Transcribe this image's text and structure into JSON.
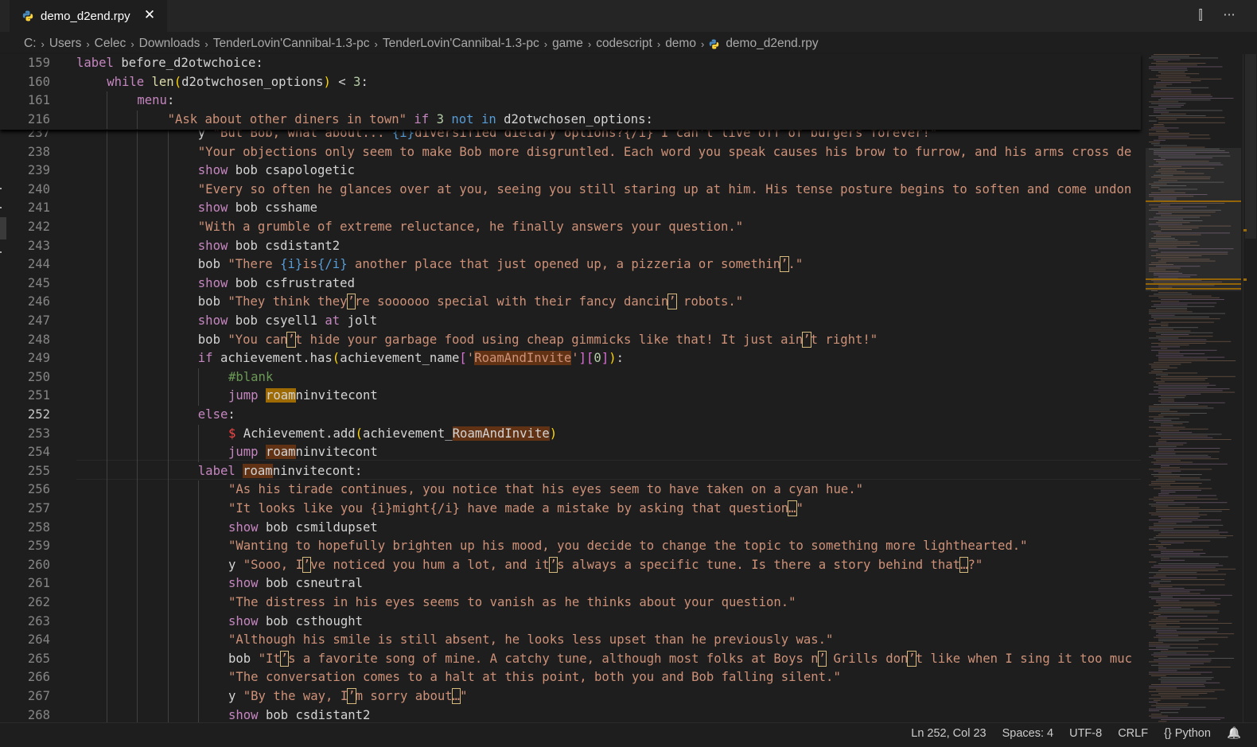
{
  "tab": {
    "filename": "demo_d2end.rpy",
    "close": "✕"
  },
  "tab_actions": {
    "split": "⫿",
    "more": "···"
  },
  "breadcrumb": [
    "C:",
    "Users",
    "Celec",
    "Downloads",
    "TenderLovin'Cannibal-1.3-pc",
    "TenderLovin'Cannibal-1.3-pc",
    "game",
    "codescript",
    "demo",
    "demo_d2end.rpy"
  ],
  "sticky_lines": [
    {
      "n": "159",
      "i": 0,
      "html": "<span class=\"kw\">label</span> before_d2otwchoice:"
    },
    {
      "n": "160",
      "i": 1,
      "html": "<span class=\"ctrl\">while</span> <span class=\"fn\">len</span><span class=\"y1\">(</span>d2otwchosen_options<span class=\"y1\">)</span> &lt; <span class=\"num\">3</span>:"
    },
    {
      "n": "161",
      "i": 2,
      "html": "<span class=\"kw\">menu</span>:"
    },
    {
      "n": "216",
      "i": 3,
      "html": "<span class=\"str\">\"Ask about other diners in town\"</span> <span class=\"ctrl\">if</span> <span class=\"num\">3</span> <span class=\"bl\">not</span> <span class=\"bl\">in</span> d2otwchosen_options:"
    }
  ],
  "lines": [
    {
      "n": "237",
      "i": 4,
      "html": "y <span class=\"str\">\"But Bob, what about... </span><span class=\"bl\">{i}</span><span class=\"str\">diversified dietary options?{/i} I can't live off of burgers forever!\"</span>"
    },
    {
      "n": "238",
      "i": 4,
      "html": "<span class=\"str\">\"Your objections only seem to make Bob more disgruntled. Each word you speak causes his brow to furrow, and his arms cross de</span>"
    },
    {
      "n": "239",
      "i": 4,
      "html": "<span class=\"kw\">show</span> bob csapologetic"
    },
    {
      "n": "240",
      "i": 4,
      "html": "<span class=\"str\">\"Every so often he glances over at you, seeing you still staring up at him. His tense posture begins to soften and come undon</span>"
    },
    {
      "n": "241",
      "i": 4,
      "html": "<span class=\"kw\">show</span> bob csshame"
    },
    {
      "n": "242",
      "i": 4,
      "html": "<span class=\"str\">\"With a grumble of extreme reluctance, he finally answers your question.\"</span>"
    },
    {
      "n": "243",
      "i": 4,
      "html": "<span class=\"kw\">show</span> bob csdistant2"
    },
    {
      "n": "244",
      "i": 4,
      "html": "bob <span class=\"str\">\"There </span><span class=\"bl\">{i}</span><span class=\"str\">is</span><span class=\"bl\">{/i}</span><span class=\"str\"> another place that just opened up, a pizzeria or somethin<span class=\"uc\">’</span>.\"</span>"
    },
    {
      "n": "245",
      "i": 4,
      "html": "<span class=\"kw\">show</span> bob csfrustrated"
    },
    {
      "n": "246",
      "i": 4,
      "html": "bob <span class=\"str\">\"They think they<span class=\"uc\">’</span>re soooooo special with their fancy dancin<span class=\"uc\">’</span> robots.\"</span>"
    },
    {
      "n": "247",
      "i": 4,
      "html": "<span class=\"kw\">show</span> bob csyell1 <span class=\"kw\">at</span> jolt"
    },
    {
      "n": "248",
      "i": 4,
      "html": "bob <span class=\"str\">\"You can<span class=\"uc\">’</span>t hide your garbage food using cheap gimmicks like that! It just ain<span class=\"uc\">’</span>t right!\"</span>"
    },
    {
      "n": "249",
      "i": 4,
      "html": "<span class=\"ctrl\">if</span> achievement.has<span class=\"y1\">(</span>achievement_name<span class=\"y2\">[</span><span class=\"str\">'<span class=\"hl\">RoamAndInvite</span>'</span><span class=\"y2\">]</span><span class=\"y2\">[</span><span class=\"num\">0</span><span class=\"y2\">]</span><span class=\"y1\">)</span>:"
    },
    {
      "n": "250",
      "i": 5,
      "html": "<span class=\"cm\">#blank</span>"
    },
    {
      "n": "251",
      "i": 5,
      "html": "<span class=\"kw\">jump</span> <span class=\"hl2\">roam</span>ninvitecont"
    },
    {
      "n": "252",
      "i": 4,
      "html": "<span class=\"ctrl\">else</span>:",
      "active": true
    },
    {
      "n": "253",
      "i": 5,
      "html": "<span class=\"red\">$</span> Achievement.add<span class=\"y1\">(</span>achievement_<span class=\"hl\">RoamAndInvite</span><span class=\"y1\">)</span>"
    },
    {
      "n": "254",
      "i": 5,
      "html": "<span class=\"kw\">jump</span> <span class=\"hl\">roam</span>ninvitecont"
    },
    {
      "n": "255",
      "i": 4,
      "html": "<span class=\"kw\">label</span> <span class=\"hl\">roam</span>ninvitecont:"
    },
    {
      "n": "256",
      "i": 5,
      "html": "<span class=\"str\">\"As his tirade continues, you notice that his eyes seem to have taken on a cyan hue.\"</span>"
    },
    {
      "n": "257",
      "i": 5,
      "html": "<span class=\"str\">\"It looks like you {i}might{/i} have made a mistake by asking that question<span class=\"uc\">…</span>\"</span>"
    },
    {
      "n": "258",
      "i": 5,
      "html": "<span class=\"kw\">show</span> bob csmildupset"
    },
    {
      "n": "259",
      "i": 5,
      "html": "<span class=\"str\">\"Wanting to hopefully brighten up his mood, you decide to change the topic to something more lighthearted.\"</span>"
    },
    {
      "n": "260",
      "i": 5,
      "html": "y <span class=\"str\">\"Sooo, I<span class=\"uc\">’</span>ve noticed you hum a lot, and it<span class=\"uc\">’</span>s always a specific tune. Is there a story behind that<span class=\"uc\">…</span>?\"</span>"
    },
    {
      "n": "261",
      "i": 5,
      "html": "<span class=\"kw\">show</span> bob csneutral"
    },
    {
      "n": "262",
      "i": 5,
      "html": "<span class=\"str\">\"The distress in his eyes seems to vanish as he thinks about your question.\"</span>"
    },
    {
      "n": "263",
      "i": 5,
      "html": "<span class=\"kw\">show</span> bob csthought"
    },
    {
      "n": "264",
      "i": 5,
      "html": "<span class=\"str\">\"Although his smile is still absent, he looks less upset than he previously was.\"</span>"
    },
    {
      "n": "265",
      "i": 5,
      "html": "bob <span class=\"str\">\"It<span class=\"uc\">’</span>s a favorite song of mine. A catchy tune, although most folks at Boys n<span class=\"uc\">’</span> Grills don<span class=\"uc\">’</span>t like when I sing it too muc</span>"
    },
    {
      "n": "266",
      "i": 5,
      "html": "<span class=\"str\">\"The conversation comes to a halt at this point, both you and Bob falling silent.\"</span>"
    },
    {
      "n": "267",
      "i": 5,
      "html": "y <span class=\"str\">\"By the way, I<span class=\"uc\">’</span>m sorry about<span class=\"uc\">…</span>\"</span>"
    },
    {
      "n": "268",
      "i": 5,
      "html": "<span class=\"kw\">show</span> bob csdistant2"
    }
  ],
  "status": {
    "position": "Ln 252, Col 23",
    "spaces": "Spaces: 4",
    "encoding": "UTF-8",
    "eol": "CRLF",
    "language_icon": "{}",
    "language": "Python",
    "bell": "🔔"
  }
}
